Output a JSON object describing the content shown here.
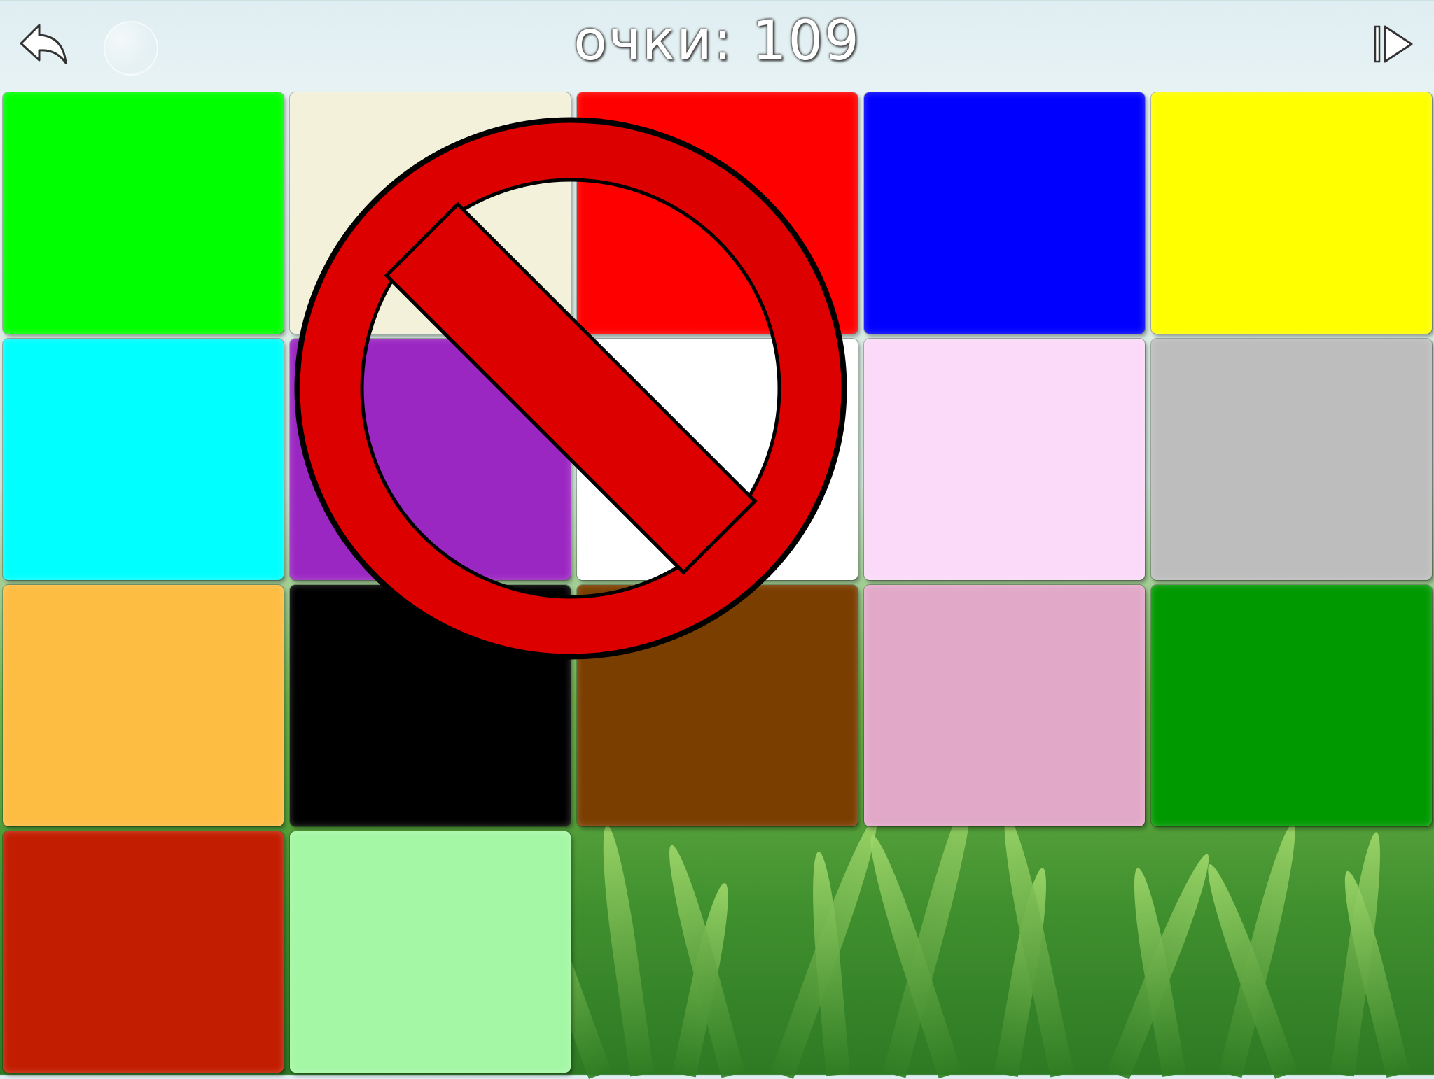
{
  "hud": {
    "score_text": "очки: 109",
    "back_icon": "back-arrow-icon",
    "next_icon": "skip-forward-icon"
  },
  "tiles": [
    {
      "name": "green",
      "color": "#00ff00"
    },
    {
      "name": "beige",
      "color": "#f3f1da"
    },
    {
      "name": "red",
      "color": "#ff0000"
    },
    {
      "name": "blue",
      "color": "#0000ff"
    },
    {
      "name": "yellow",
      "color": "#ffff00"
    },
    {
      "name": "cyan",
      "color": "#00ffff"
    },
    {
      "name": "purple",
      "color": "#9b27c2"
    },
    {
      "name": "white",
      "color": "#ffffff"
    },
    {
      "name": "light-pink",
      "color": "#fadaf8"
    },
    {
      "name": "gray",
      "color": "#bdbdbd"
    },
    {
      "name": "orange",
      "color": "#fdbc42"
    },
    {
      "name": "black",
      "color": "#000000"
    },
    {
      "name": "brown",
      "color": "#7a3e00"
    },
    {
      "name": "dusty-pink",
      "color": "#e2a8c8"
    },
    {
      "name": "dark-green",
      "color": "#009900"
    },
    {
      "name": "dark-red",
      "color": "#c21d00"
    },
    {
      "name": "light-green",
      "color": "#a4f7a4"
    }
  ],
  "overlay": {
    "icon": "prohibited-sign-icon",
    "color": "#dd0000",
    "outline": "#000000"
  }
}
